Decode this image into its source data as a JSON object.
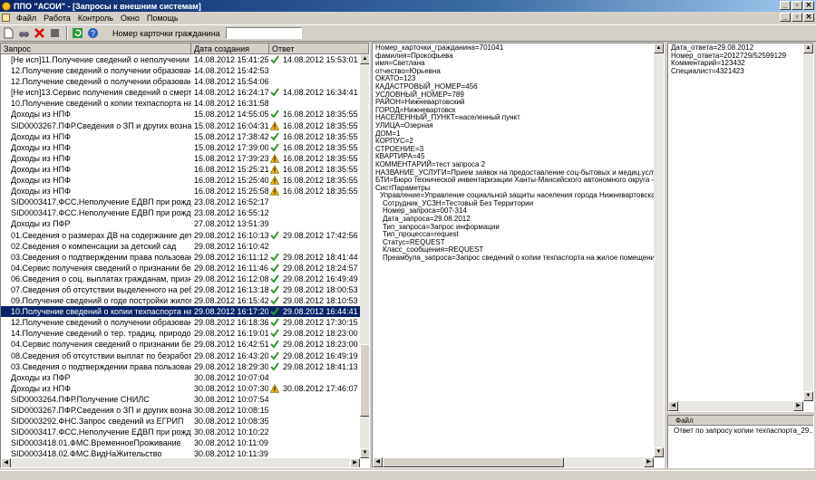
{
  "window": {
    "title": "ППО \"АСОИ\" - [Запросы к внешним системам]"
  },
  "menu": [
    "Файл",
    "Работа",
    "Контроль",
    "Окно",
    "Помощь"
  ],
  "toolbar": {
    "card_label": "Номер карточки гражданина",
    "card_value": ""
  },
  "grid": {
    "headers": {
      "request": "Запрос",
      "created": "Дата создания",
      "answer": "Ответ"
    },
    "rows": [
      {
        "request": "[Не исп]11.Получение сведений о неполучении инва...",
        "created": "14.08.2012 15:41:25",
        "status": "ok",
        "answer": "14.08.2012 15:53:01"
      },
      {
        "request": "12.Получение сведений о получении образования в ...",
        "created": "14.08.2012 15:42:53",
        "status": "",
        "answer": ""
      },
      {
        "request": "12.Получение сведений о получении образования в ...",
        "created": "14.08.2012 15:54:06",
        "status": "",
        "answer": ""
      },
      {
        "request": "[Не исп]13.Сервис получения сведений  о смерти ф...",
        "created": "14.08.2012 16:24:17",
        "status": "ok",
        "answer": "14.08.2012 16:34:41"
      },
      {
        "request": "10.Получение сведений о копии техпаспорта на жил...",
        "created": "14.08.2012 16:31:58",
        "status": "",
        "answer": ""
      },
      {
        "request": "Доходы из НПФ",
        "created": "15.08.2012 14:55:05",
        "status": "ok",
        "answer": "16.08.2012 18:35:55"
      },
      {
        "request": "SID0003267.ПФР.Сведения о ЗП и других вознагра...",
        "created": "15.08.2012 16:04:31",
        "status": "warn",
        "answer": "16.08.2012 18:35:55"
      },
      {
        "request": "Доходы из НПФ",
        "created": "15.08.2012 17:38:42",
        "status": "ok",
        "answer": "16.08.2012 18:35:55"
      },
      {
        "request": "Доходы из НПФ",
        "created": "15.08.2012 17:39:00",
        "status": "ok",
        "answer": "16.08.2012 18:35:55"
      },
      {
        "request": "Доходы из НПФ",
        "created": "15.08.2012 17:39:23",
        "status": "warn",
        "answer": "16.08.2012 18:35:55"
      },
      {
        "request": "Доходы из НПФ",
        "created": "16.08.2012 15:25:21",
        "status": "warn",
        "answer": "16.08.2012 18:35:55"
      },
      {
        "request": "Доходы из НПФ",
        "created": "16.08.2012 15:25:40",
        "status": "warn",
        "answer": "16.08.2012 18:35:55"
      },
      {
        "request": "Доходы из НПФ",
        "created": "16.08.2012 15:25:58",
        "status": "warn",
        "answer": "16.08.2012 18:35:55"
      },
      {
        "request": "SID0003417.ФСС.Неполучение ЕДВП при рождении...",
        "created": "23.08.2012 16:52:17",
        "status": "",
        "answer": ""
      },
      {
        "request": "SID0003417.ФСС.Неполучение ЕДВП при рождении...",
        "created": "23.08.2012 16:55:12",
        "status": "",
        "answer": ""
      },
      {
        "request": "Доходы из ПФР",
        "created": "27.08.2012 13:51:39",
        "status": "",
        "answer": ""
      },
      {
        "request": "01.Сведения о размерах ДВ на содержание детей-с...",
        "created": "29.08.2012 16:10:13",
        "status": "ok",
        "answer": "29.08.2012 17:42:56"
      },
      {
        "request": "02.Сведения о компенсации за детский сад",
        "created": "29.08.2012 16:10:42",
        "status": "",
        "answer": ""
      },
      {
        "request": "03.Сведения о подтверждении права пользования ...",
        "created": "29.08.2012 16:11:12",
        "status": "ok",
        "answer": "29.08.2012 18:41:44"
      },
      {
        "request": "04.Сервис получения сведений о признании безраб...",
        "created": "29.08.2012 16:11:46",
        "status": "ok",
        "answer": "29.08.2012 18:24:57"
      },
      {
        "request": "06.Сведения о соц. выплатах гражданам, признанн...",
        "created": "29.08.2012 16:12:08",
        "status": "ok",
        "answer": "29.08.2012 16:49:49"
      },
      {
        "request": "07.Сведения об отсутствии выделенного на ребенк...",
        "created": "29.08.2012 16:13:18",
        "status": "ok",
        "answer": "29.08.2012 18:00:53"
      },
      {
        "request": "09.Получение сведений о годе постройки жилого до...",
        "created": "29.08.2012 16:15:42",
        "status": "ok",
        "answer": "29.08.2012 18:10:53"
      },
      {
        "request": "10.Получение сведений о копии техпаспорта на жил...",
        "created": "29.08.2012 16:17:20",
        "status": "ok",
        "answer": "29.08.2012 16:44:41",
        "selected": true
      },
      {
        "request": "12.Получение сведений о получении образования в ...",
        "created": "29.08.2012 16:18:36",
        "status": "ok",
        "answer": "29.08.2012 17:30:15"
      },
      {
        "request": "14.Получение сведений о тер. традиц. природополь...",
        "created": "29.08.2012 16:19:01",
        "status": "ok",
        "answer": "29.08.2012 18:23:00"
      },
      {
        "request": "04.Сервис получения сведений о признании безраб...",
        "created": "29.08.2012 16:42:51",
        "status": "ok",
        "answer": "29.08.2012 18:23:00"
      },
      {
        "request": "08.Сведения об отсутствии выплат по безработице ...",
        "created": "29.08.2012 16:43:20",
        "status": "ok",
        "answer": "29.08.2012 16:49:19"
      },
      {
        "request": "03.Сведения о подтверждении права пользования ...",
        "created": "29.08.2012 18:29:30",
        "status": "ok",
        "answer": "29.08.2012 18:41:13"
      },
      {
        "request": "Доходы из ПФР",
        "created": "30.08.2012 10:07:04",
        "status": "",
        "answer": ""
      },
      {
        "request": "Доходы из НПФ",
        "created": "30.08.2012 10:07:30",
        "status": "warn",
        "answer": "30.08.2012 17:46:07"
      },
      {
        "request": "SID0003264.ПФР.Получение СНИЛС",
        "created": "30.08.2012 10:07:54",
        "status": "",
        "answer": ""
      },
      {
        "request": "SID0003267.ПФР.Сведения о ЗП и других вознагра...",
        "created": "30.08.2012 10:08:15",
        "status": "",
        "answer": ""
      },
      {
        "request": "SID0003292.ФНС.Запрос сведений из ЕГРИП",
        "created": "30.08.2012 10:08:35",
        "status": "",
        "answer": ""
      },
      {
        "request": "SID0003417.ФСС.Неполучение ЕДВП при рождении...",
        "created": "30.08.2012 10:10:22",
        "status": "",
        "answer": ""
      },
      {
        "request": "SID0003418.01.ФМС.ВременноеПроживание",
        "created": "30.08.2012 10:11:09",
        "status": "",
        "answer": ""
      },
      {
        "request": "SID0003418.02.ФМС.ВидНаЖительство",
        "created": "30.08.2012 10:11:39",
        "status": "",
        "answer": ""
      }
    ]
  },
  "detail": {
    "lines": [
      {
        "text": "Номер_карточки_гражданина=701041",
        "indent": 0
      },
      {
        "text": "фамилия=Прокофьева",
        "indent": 0
      },
      {
        "text": "имя=Светлана",
        "indent": 0
      },
      {
        "text": "отчество=Юрьевна",
        "indent": 0
      },
      {
        "text": "ОКАТО=123",
        "indent": 0
      },
      {
        "text": "КАДАСТРОВЫЙ_НОМЕР=456",
        "indent": 0
      },
      {
        "text": "УСЛОВНЫЙ_НОМЕР=789",
        "indent": 0
      },
      {
        "text": "РАЙОН=Нижневартовский",
        "indent": 0
      },
      {
        "text": "ГОРОД=Нижневартовск",
        "indent": 0
      },
      {
        "text": "НАСЕЛЕННЫЙ_ПУНКТ=населенный пункт",
        "indent": 0
      },
      {
        "text": "УЛИЦА=Озерная",
        "indent": 0
      },
      {
        "text": "ДОМ=1",
        "indent": 0
      },
      {
        "text": "КОРПУС=2",
        "indent": 0
      },
      {
        "text": "СТРОЕНИЕ=3",
        "indent": 0
      },
      {
        "text": "КВАРТИРА=45",
        "indent": 0
      },
      {
        "text": "КОММЕНТАРИЙ=тест запроса 2",
        "indent": 0
      },
      {
        "text": "НАЗВАНИЕ_УСЛУГИ=Прием заявок на предоставление соц-бытовых и медиц.услуг",
        "indent": 0
      },
      {
        "text": "БТИ=Бюро технической инвентаризации Ханты-Мансийского автономного округа - Ю",
        "indent": 0
      },
      {
        "text": "СистПараметры",
        "indent": 0
      },
      {
        "text": "Управление=Управление социальной защиты населения города Нижневартовска",
        "indent": 1
      },
      {
        "text": "Сотрудник_УСЗН=Тестовый Без Территории",
        "indent": 2
      },
      {
        "text": "Номер_запроса=007-314",
        "indent": 2
      },
      {
        "text": "Дата_запроса=29.08.2012",
        "indent": 2
      },
      {
        "text": "Тип_запроса=Запрос информации",
        "indent": 2
      },
      {
        "text": "Тип_процесса=request",
        "indent": 2
      },
      {
        "text": "Статус=REQUEST",
        "indent": 2
      },
      {
        "text": "Класс_сообщения=REQUEST",
        "indent": 2
      },
      {
        "text": "Преамбула_запроса=Запрос сведений о копии техпаспорта на жилое помещение",
        "indent": 2
      }
    ]
  },
  "answer": {
    "lines": [
      "Дата_ответа=29.08.2012",
      "Номер_ответа=2012729/52599129",
      "Комментарий=123432",
      "Специалист=4321423"
    ]
  },
  "files": {
    "header": "Файл",
    "items": [
      "Ответ по запросу копии техпаспорта_29...."
    ]
  },
  "colors": {
    "selection": "#0a246a",
    "ok": "#2f9a2f",
    "warn": "#e8b400",
    "chrome": "#d4d0c8"
  }
}
